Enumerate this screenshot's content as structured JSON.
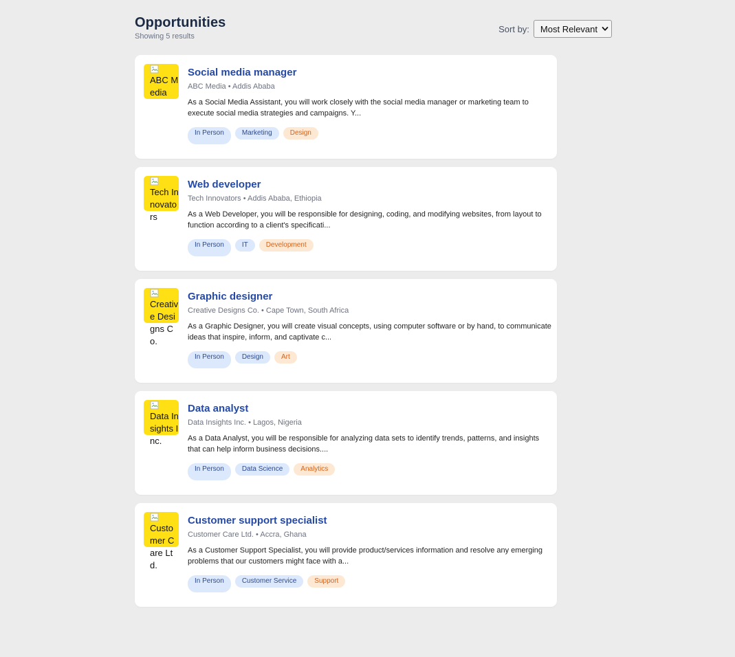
{
  "header": {
    "title": "Opportunities",
    "result_count": "Showing 5 results",
    "sort_label": "Sort by:",
    "sort_value": "Most Relevant"
  },
  "colors": {
    "background": "#ececec",
    "card": "#ffffff",
    "logo_bg": "#ffe014",
    "title_blue": "#2449a6",
    "tag_blue_bg": "#dce8fb",
    "tag_orange_bg": "#fde9d3",
    "tag_orange_text": "#d5621c"
  },
  "jobs": [
    {
      "logo_alt": "ABC Media",
      "title": "Social media manager",
      "company": "ABC Media",
      "location": "Addis Ababa",
      "description": "As a Social Media Assistant, you will work closely with the social media manager or marketing team to execute social media strategies and campaigns. Y...",
      "mode": "In Person",
      "tags": [
        "Marketing",
        "Design"
      ]
    },
    {
      "logo_alt": "Tech Innovators",
      "title": "Web developer",
      "company": "Tech Innovators",
      "location": "Addis Ababa, Ethiopia",
      "description": "As a Web Developer, you will be responsible for designing, coding, and modifying websites, from layout to function according to a client's specificati...",
      "mode": "In Person",
      "tags": [
        "IT",
        "Development"
      ]
    },
    {
      "logo_alt": "Creative Designs Co.",
      "title": "Graphic designer",
      "company": "Creative Designs Co.",
      "location": "Cape Town, South Africa",
      "description": "As a Graphic Designer, you will create visual concepts, using computer software or by hand, to communicate ideas that inspire, inform, and captivate c...",
      "mode": "In Person",
      "tags": [
        "Design",
        "Art"
      ]
    },
    {
      "logo_alt": "Data Insights Inc.",
      "title": "Data analyst",
      "company": "Data Insights Inc.",
      "location": "Lagos, Nigeria",
      "description": "As a Data Analyst, you will be responsible for analyzing data sets to identify trends, patterns, and insights that can help inform business decisions....",
      "mode": "In Person",
      "tags": [
        "Data Science",
        "Analytics"
      ]
    },
    {
      "logo_alt": "Customer Care Ltd.",
      "title": "Customer support specialist",
      "company": "Customer Care Ltd.",
      "location": "Accra, Ghana",
      "description": "As a Customer Support Specialist, you will provide product/services information and resolve any emerging problems that our customers might face with a...",
      "mode": "In Person",
      "tags": [
        "Customer Service",
        "Support"
      ]
    }
  ]
}
